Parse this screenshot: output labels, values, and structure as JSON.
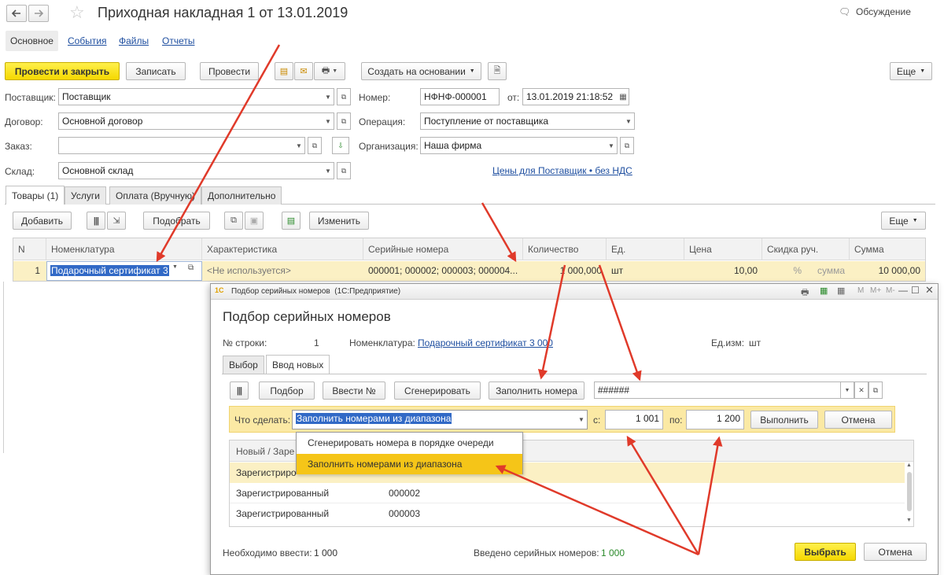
{
  "doc": {
    "title": "Приходная накладная 1 от 13.01.2019",
    "discussion": "Обсуждение",
    "nav": [
      "Основное",
      "События",
      "Файлы",
      "Отчеты"
    ],
    "toolbar": {
      "post_close": "Провести и закрыть",
      "save": "Записать",
      "post": "Провести",
      "create_based": "Создать на основании",
      "more": "Еще"
    },
    "fields": {
      "supplier_label": "Поставщик:",
      "supplier": "Поставщик",
      "contract_label": "Договор:",
      "contract": "Основной договор",
      "order_label": "Заказ:",
      "order": "",
      "warehouse_label": "Склад:",
      "warehouse": "Основной склад",
      "number_label": "Номер:",
      "number": "НФНФ-000001",
      "from_label": "от:",
      "date": "13.01.2019 21:18:52",
      "operation_label": "Операция:",
      "operation": "Поступление от поставщика",
      "org_label": "Организация:",
      "org": "Наша фирма",
      "prices_link": "Цены для Поставщик • без НДС"
    },
    "tabs": [
      "Товары (1)",
      "Услуги",
      "Оплата (Вручную)",
      "Дополнительно"
    ],
    "table_toolbar": {
      "add": "Добавить",
      "pick": "Подобрать",
      "change": "Изменить",
      "more": "Еще"
    },
    "table": {
      "headers": [
        "N",
        "Номенклатура",
        "Характеристика",
        "Серийные номера",
        "Количество",
        "Ед.",
        "Цена",
        "Скидка руч.",
        "Сумма"
      ],
      "row": {
        "n": "1",
        "item": "Подарочный сертификат 3",
        "characteristic": "<Не используется>",
        "serials": "000001; 000002; 000003; 000004...",
        "qty": "1 000,000",
        "unit": "шт",
        "price": "10,00",
        "discount_pct": "%",
        "discount_sum": "сумма",
        "sum": "10 000,00"
      }
    }
  },
  "dialog": {
    "window_title": "Подбор серийных номеров  (1С:Предприятие)",
    "window_controls": [
      "M",
      "M+",
      "M-"
    ],
    "heading": "Подбор серийных номеров",
    "row_label": "№ строки:",
    "row_value": "1",
    "item_label": "Номенклатура:",
    "item_value": "Подарочный сертификат 3 000",
    "unit_label": "Ед.изм:",
    "unit_value": "шт",
    "tabs": [
      "Выбор",
      "Ввод новых"
    ],
    "toolbar": {
      "pick": "Подбор",
      "enter_numbers": "Ввести №",
      "generate": "Сгенерировать",
      "fill_numbers": "Заполнить номера",
      "mask": "######"
    },
    "action": {
      "label": "Что сделать:",
      "value": "Заполнить номерами из диапазона",
      "from_label": "с:",
      "from_value": "1 001",
      "to_label": "по:",
      "to_value": "1 200",
      "execute": "Выполнить",
      "cancel": "Отмена"
    },
    "dropdown_options": [
      "Сгенерировать номера в порядке очереди",
      "Заполнить номерами из диапазона"
    ],
    "list": {
      "header": "Новый / Заре",
      "rows": [
        {
          "status": "Зарегистриро",
          "number": ""
        },
        {
          "status": "Зарегистрированный",
          "number": "000002"
        },
        {
          "status": "Зарегистрированный",
          "number": "000003"
        }
      ]
    },
    "footer": {
      "need_label": "Необходимо ввести:",
      "need_value": "1 000",
      "entered_label": "Введено серийных номеров:",
      "entered_value": "1 000",
      "select": "Выбрать",
      "cancel": "Отмена"
    }
  },
  "colors": {
    "accent_yellow": "#f5d800",
    "row_highlight": "#fbf0c4",
    "arrow_red": "#e03a2a",
    "link_blue": "#1f4fa0",
    "green_value": "#2a8a2a"
  }
}
